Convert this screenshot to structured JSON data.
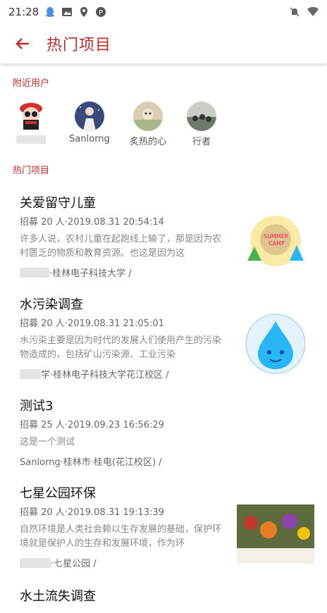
{
  "status": {
    "time": "21:28"
  },
  "header": {
    "title": "热门项目"
  },
  "nearby": {
    "label": "附近用户",
    "users": [
      {
        "name": ""
      },
      {
        "name": "Sanlorng"
      },
      {
        "name": "炙热的心"
      },
      {
        "name": "行者"
      }
    ]
  },
  "hot": {
    "label": "热门项目",
    "items": [
      {
        "title": "关爱留守儿童",
        "meta": "招募 20 人·2019.08.31 20:54:14",
        "desc": "许多人说，农村儿童在起跑线上输了，那是因为农村匮乏的物质和教育资源。也这是因为这",
        "loc": "·桂林电子科技大学 /"
      },
      {
        "title": "水污染调查",
        "meta": "招募 20 人·2019.08.31 21:05:01",
        "desc": "水污染主要是因为时代的发展人们使用产生的污染物造成的，包括矿山污染源、工业污染",
        "loc": "学·桂林电子科技大学花江校区 /"
      },
      {
        "title": "测试3",
        "meta": "招募 25 人·2019.09.23 16:56:29",
        "desc": "这是一个测试",
        "loc": "Sanlorng·桂林市·桂电(花江校区) /"
      },
      {
        "title": "七星公园环保",
        "meta": "招募 20 人·2019.08.31 19:13:39",
        "desc": "自然环境是人类社会赖以生存发展的基础，保护环境就是保护人的生存和发展环境，作为环",
        "loc": "·七星公园 /"
      },
      {
        "title": "水土流失调查"
      }
    ]
  }
}
